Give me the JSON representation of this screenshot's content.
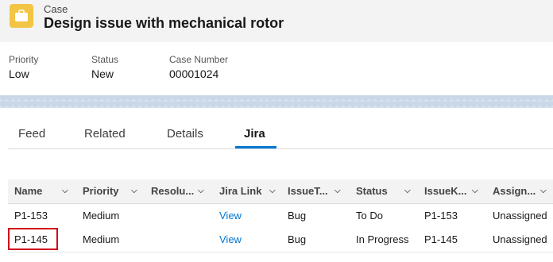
{
  "header": {
    "object_type": "Case",
    "title": "Design issue with mechanical rotor",
    "icon": "briefcase-icon",
    "icon_color": "#f2c544"
  },
  "highlights": [
    {
      "label": "Priority",
      "value": "Low"
    },
    {
      "label": "Status",
      "value": "New"
    },
    {
      "label": "Case Number",
      "value": "00001024"
    }
  ],
  "tabs": [
    {
      "label": "Feed",
      "active": false
    },
    {
      "label": "Related",
      "active": false
    },
    {
      "label": "Details",
      "active": false
    },
    {
      "label": "Jira",
      "active": true
    }
  ],
  "table": {
    "columns": [
      "Name",
      "Priority",
      "Resolu...",
      "Jira Link",
      "IssueT...",
      "Status",
      "IssueK...",
      "Assign..."
    ],
    "rows": [
      [
        "P1-153",
        "Medium",
        "",
        "View",
        "Bug",
        "To Do",
        "P1-153",
        "Unassigned"
      ],
      [
        "P1-145",
        "Medium",
        "",
        "View",
        "Bug",
        "In Progress",
        "P1-145",
        "Unassigned"
      ]
    ]
  },
  "colors": {
    "accent": "#0176d3",
    "highlight_border": "#d0021b"
  }
}
